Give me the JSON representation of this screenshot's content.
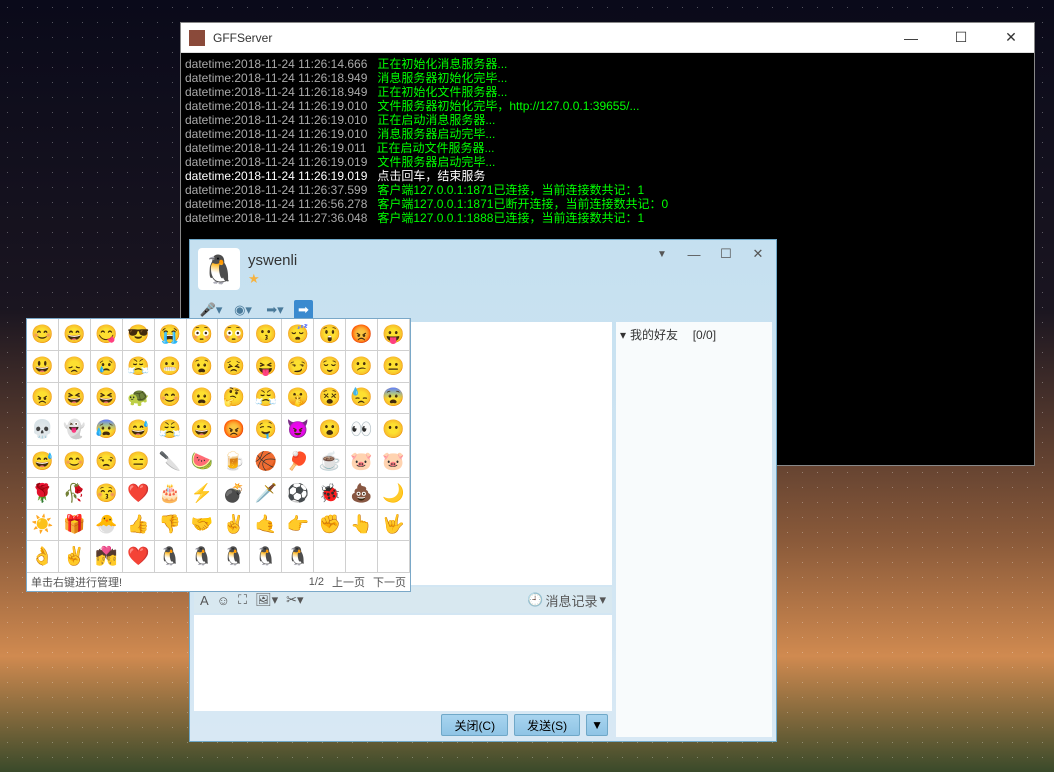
{
  "console": {
    "title": "GFFServer",
    "logs": [
      {
        "dt": "datetime:",
        "ts": "2018-11-24 11:26:14.666",
        "msg": "   正在初始化消息服务器..."
      },
      {
        "dt": "datetime:",
        "ts": "2018-11-24 11:26:18.949",
        "msg": "   消息服务器初始化完毕..."
      },
      {
        "dt": "datetime:",
        "ts": "2018-11-24 11:26:18.949",
        "msg": "   正在初始化文件服务器..."
      },
      {
        "dt": "datetime:",
        "ts": "2018-11-24 11:26:19.010",
        "msg": "   文件服务器初始化完毕，http://127.0.0.1:39655/..."
      },
      {
        "dt": "datetime:",
        "ts": "2018-11-24 11:26:19.010",
        "msg": "   正在启动消息服务器..."
      },
      {
        "dt": "datetime:",
        "ts": "2018-11-24 11:26:19.010",
        "msg": "   消息服务器启动完毕..."
      },
      {
        "dt": "datetime:",
        "ts": "2018-11-24 11:26:19.011",
        "msg": "   正在启动文件服务器..."
      },
      {
        "dt": "datetime:",
        "ts": "2018-11-24 11:26:19.019",
        "msg": "   文件服务器启动完毕..."
      },
      {
        "dt": "datetime:",
        "ts": "2018-11-24 11:26:19.019",
        "msg": "   点击回车，结束服务",
        "white": true
      },
      {
        "dt": "datetime:",
        "ts": "2018-11-24 11:26:37.599",
        "msg": "   客户端127.0.0.1:1871已连接，当前连接数共记：1"
      },
      {
        "dt": "datetime:",
        "ts": "2018-11-24 11:26:56.278",
        "msg": "   客户端127.0.0.1:1871已断开连接，当前连接数共记：0"
      },
      {
        "dt": "datetime:",
        "ts": "2018-11-24 11:27:36.048",
        "msg": "   客户端127.0.0.1:1888已连接，当前连接数共记：1"
      }
    ]
  },
  "chat": {
    "username": "yswenli",
    "avatar_emoji": "🐧",
    "star": "★",
    "history_label": "消息记录",
    "close_btn": "关闭(C)",
    "send_btn": "发送(S)",
    "friends_header": "我的好友",
    "friends_count": "[0/0]"
  },
  "emoji": {
    "footer_hint": "单击右键进行管理!",
    "page_indicator": "1/2",
    "prev_label": "上一页",
    "next_label": "下一页",
    "cells": [
      "😊",
      "😄",
      "😋",
      "😎",
      "😭",
      "😳",
      "😳",
      "😗",
      "😴",
      "😲",
      "😡",
      "😛",
      "😃",
      "😞",
      "😢",
      "😤",
      "😬",
      "😧",
      "😣",
      "😝",
      "😏",
      "😌",
      "😕",
      "😐",
      "😠",
      "😆",
      "😆",
      "🐢",
      "😊",
      "😦",
      "🤔",
      "😤",
      "🤫",
      "😵",
      "😓",
      "😨",
      "💀",
      "👻",
      "😰",
      "😅",
      "😤",
      "😀",
      "😡",
      "🤤",
      "😈",
      "😮",
      "👀",
      "😶",
      "😅",
      "😊",
      "😒",
      "😑",
      "🔪",
      "🍉",
      "🍺",
      "🏀",
      "🏓",
      "☕",
      "🐷",
      "🐷",
      "🌹",
      "🥀",
      "😚",
      "❤️",
      "🎂",
      "⚡",
      "💣",
      "🗡️",
      "⚽",
      "🐞",
      "💩",
      "🌙",
      "☀️",
      "🎁",
      "🐣",
      "👍",
      "👎",
      "🤝",
      "✌️",
      "🤙",
      "👉",
      "✊",
      "👆",
      "🤟",
      "👌",
      "✌️",
      "💏",
      "❤️",
      "🐧",
      "🐧",
      "🐧",
      "🐧",
      "🐧"
    ]
  }
}
